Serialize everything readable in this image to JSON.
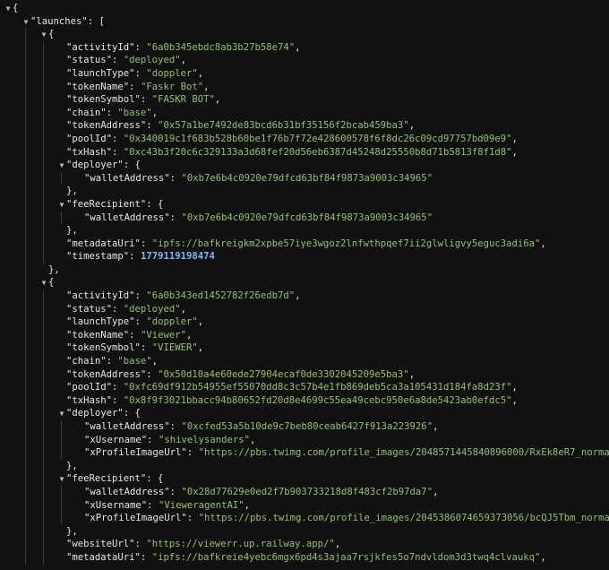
{
  "colors": {
    "background": "#111111",
    "key": "#e6e6e6",
    "string": "#8fc36b",
    "number": "#7fb6f5"
  },
  "lines": [
    {
      "d": 0,
      "t": "c",
      "parts": [
        {
          "p": "{"
        }
      ]
    },
    {
      "d": 1,
      "t": "c",
      "parts": [
        {
          "k": "\"launches\""
        },
        {
          "p": ": ["
        }
      ]
    },
    {
      "d": 2,
      "t": "c",
      "parts": [
        {
          "p": "{"
        }
      ]
    },
    {
      "d": 3,
      "t": "n",
      "parts": [
        {
          "k": "\"activityId\""
        },
        {
          "p": ": "
        },
        {
          "s": "\"6a0b345ebdc8ab3b27b58e74\""
        },
        {
          "p": ","
        }
      ]
    },
    {
      "d": 3,
      "t": "n",
      "parts": [
        {
          "k": "\"status\""
        },
        {
          "p": ": "
        },
        {
          "s": "\"deployed\""
        },
        {
          "p": ","
        }
      ]
    },
    {
      "d": 3,
      "t": "n",
      "parts": [
        {
          "k": "\"launchType\""
        },
        {
          "p": ": "
        },
        {
          "s": "\"doppler\""
        },
        {
          "p": ","
        }
      ]
    },
    {
      "d": 3,
      "t": "n",
      "parts": [
        {
          "k": "\"tokenName\""
        },
        {
          "p": ": "
        },
        {
          "s": "\"Faskr Bot\""
        },
        {
          "p": ","
        }
      ]
    },
    {
      "d": 3,
      "t": "n",
      "parts": [
        {
          "k": "\"tokenSymbol\""
        },
        {
          "p": ": "
        },
        {
          "s": "\"FASKR BOT\""
        },
        {
          "p": ","
        }
      ]
    },
    {
      "d": 3,
      "t": "n",
      "parts": [
        {
          "k": "\"chain\""
        },
        {
          "p": ": "
        },
        {
          "s": "\"base\""
        },
        {
          "p": ","
        }
      ]
    },
    {
      "d": 3,
      "t": "n",
      "parts": [
        {
          "k": "\"tokenAddress\""
        },
        {
          "p": ": "
        },
        {
          "s": "\"0x57a1be7492de83bcd6b31bf35156f2bcab459ba3\""
        },
        {
          "p": ","
        }
      ]
    },
    {
      "d": 3,
      "t": "n",
      "parts": [
        {
          "k": "\"poolId\""
        },
        {
          "p": ": "
        },
        {
          "s": "\"0x340019c1f683b528b60be1f76b7f72e428600578f6f8dc26c09cd97757bd09e9\""
        },
        {
          "p": ","
        }
      ]
    },
    {
      "d": 3,
      "t": "n",
      "parts": [
        {
          "k": "\"txHash\""
        },
        {
          "p": ": "
        },
        {
          "s": "\"0xc43b3f20c6c329133a3d68fef20d56eb6387d45248d25550b8d71b5813f8f1d8\""
        },
        {
          "p": ","
        }
      ]
    },
    {
      "d": 3,
      "t": "c",
      "parts": [
        {
          "k": "\"deployer\""
        },
        {
          "p": ": {"
        }
      ]
    },
    {
      "d": 4,
      "t": "n",
      "parts": [
        {
          "k": "\"walletAddress\""
        },
        {
          "p": ": "
        },
        {
          "s": "\"0xb7e6b4c0920e79dfcd63bf84f9873a9003c34965\""
        }
      ]
    },
    {
      "d": 3,
      "t": "n",
      "parts": [
        {
          "p": "},"
        }
      ]
    },
    {
      "d": 3,
      "t": "c",
      "parts": [
        {
          "k": "\"feeRecipient\""
        },
        {
          "p": ": {"
        }
      ]
    },
    {
      "d": 4,
      "t": "n",
      "parts": [
        {
          "k": "\"walletAddress\""
        },
        {
          "p": ": "
        },
        {
          "s": "\"0xb7e6b4c0920e79dfcd63bf84f9873a9003c34965\""
        }
      ]
    },
    {
      "d": 3,
      "t": "n",
      "parts": [
        {
          "p": "},"
        }
      ]
    },
    {
      "d": 3,
      "t": "n",
      "parts": [
        {
          "k": "\"metadataUri\""
        },
        {
          "p": ": "
        },
        {
          "s": "\"ipfs://bafkreigkm2xpbe57iye3wgoz2lnfwthpqef7ii2glwligvy5eguc3adi6a\""
        },
        {
          "p": ","
        }
      ]
    },
    {
      "d": 3,
      "t": "n",
      "parts": [
        {
          "k": "\"timestamp\""
        },
        {
          "p": ": "
        },
        {
          "n": "1779119198474"
        }
      ]
    },
    {
      "d": 2,
      "t": "n",
      "parts": [
        {
          "p": "},"
        }
      ]
    },
    {
      "d": 2,
      "t": "c",
      "parts": [
        {
          "p": "{"
        }
      ]
    },
    {
      "d": 3,
      "t": "n",
      "parts": [
        {
          "k": "\"activityId\""
        },
        {
          "p": ": "
        },
        {
          "s": "\"6a0b343ed1452782f26edb7d\""
        },
        {
          "p": ","
        }
      ]
    },
    {
      "d": 3,
      "t": "n",
      "parts": [
        {
          "k": "\"status\""
        },
        {
          "p": ": "
        },
        {
          "s": "\"deployed\""
        },
        {
          "p": ","
        }
      ]
    },
    {
      "d": 3,
      "t": "n",
      "parts": [
        {
          "k": "\"launchType\""
        },
        {
          "p": ": "
        },
        {
          "s": "\"doppler\""
        },
        {
          "p": ","
        }
      ]
    },
    {
      "d": 3,
      "t": "n",
      "parts": [
        {
          "k": "\"tokenName\""
        },
        {
          "p": ": "
        },
        {
          "s": "\"Viewer\""
        },
        {
          "p": ","
        }
      ]
    },
    {
      "d": 3,
      "t": "n",
      "parts": [
        {
          "k": "\"tokenSymbol\""
        },
        {
          "p": ": "
        },
        {
          "s": "\"VIEWER\""
        },
        {
          "p": ","
        }
      ]
    },
    {
      "d": 3,
      "t": "n",
      "parts": [
        {
          "k": "\"chain\""
        },
        {
          "p": ": "
        },
        {
          "s": "\"base\""
        },
        {
          "p": ","
        }
      ]
    },
    {
      "d": 3,
      "t": "n",
      "parts": [
        {
          "k": "\"tokenAddress\""
        },
        {
          "p": ": "
        },
        {
          "s": "\"0x50d10a4e60ede27904ecaf0de3302045209e5ba3\""
        },
        {
          "p": ","
        }
      ]
    },
    {
      "d": 3,
      "t": "n",
      "parts": [
        {
          "k": "\"poolId\""
        },
        {
          "p": ": "
        },
        {
          "s": "\"0xfc69df912b54955ef55070dd8c3c57b4e1fb869deb5ca3a105431d184fa8d23f\""
        },
        {
          "p": ","
        }
      ]
    },
    {
      "d": 3,
      "t": "n",
      "parts": [
        {
          "k": "\"txHash\""
        },
        {
          "p": ": "
        },
        {
          "s": "\"0x8f9f3021bbacc94b80652fd20d8e4699c55ea49cebc950e6a8de5423ab0efdc5\""
        },
        {
          "p": ","
        }
      ]
    },
    {
      "d": 3,
      "t": "c",
      "parts": [
        {
          "k": "\"deployer\""
        },
        {
          "p": ": {"
        }
      ]
    },
    {
      "d": 4,
      "t": "n",
      "parts": [
        {
          "k": "\"walletAddress\""
        },
        {
          "p": ": "
        },
        {
          "s": "\"0xcfed53a5b10de9c7beb80ceab6427f913a223926\""
        },
        {
          "p": ","
        }
      ]
    },
    {
      "d": 4,
      "t": "n",
      "parts": [
        {
          "k": "\"xUsername\""
        },
        {
          "p": ": "
        },
        {
          "s": "\"shivelysanders\""
        },
        {
          "p": ","
        }
      ]
    },
    {
      "d": 4,
      "t": "n",
      "parts": [
        {
          "k": "\"xProfileImageUrl\""
        },
        {
          "p": ": "
        },
        {
          "s": "\"https://pbs.twimg.com/profile_images/2048571445840896000/RxEk8eR7_normal.jpg\""
        }
      ]
    },
    {
      "d": 3,
      "t": "n",
      "parts": [
        {
          "p": "},"
        }
      ]
    },
    {
      "d": 3,
      "t": "c",
      "parts": [
        {
          "k": "\"feeRecipient\""
        },
        {
          "p": ": {"
        }
      ]
    },
    {
      "d": 4,
      "t": "n",
      "parts": [
        {
          "k": "\"walletAddress\""
        },
        {
          "p": ": "
        },
        {
          "s": "\"0x28d77629e0ed2f7b903733218d8f483cf2b97da7\""
        },
        {
          "p": ","
        }
      ]
    },
    {
      "d": 4,
      "t": "n",
      "parts": [
        {
          "k": "\"xUsername\""
        },
        {
          "p": ": "
        },
        {
          "s": "\"VieweragentAI\""
        },
        {
          "p": ","
        }
      ]
    },
    {
      "d": 4,
      "t": "n",
      "parts": [
        {
          "k": "\"xProfileImageUrl\""
        },
        {
          "p": ": "
        },
        {
          "s": "\"https://pbs.twimg.com/profile_images/2045386074659373056/bcQJ5Tbm_normal.jpg\""
        }
      ]
    },
    {
      "d": 3,
      "t": "n",
      "parts": [
        {
          "p": "},"
        }
      ]
    },
    {
      "d": 3,
      "t": "n",
      "parts": [
        {
          "k": "\"websiteUrl\""
        },
        {
          "p": ": "
        },
        {
          "s": "\"https://viewerr.up.railway.app/\""
        },
        {
          "p": ","
        }
      ]
    },
    {
      "d": 3,
      "t": "n",
      "parts": [
        {
          "k": "\"metadataUri\""
        },
        {
          "p": ": "
        },
        {
          "s": "\"ipfs://bafkreie4yebc6mgx6pd4s3ajaa7rsjkfes5o7ndvldom3d3twq4clvaukq\""
        },
        {
          "p": ","
        }
      ]
    }
  ]
}
